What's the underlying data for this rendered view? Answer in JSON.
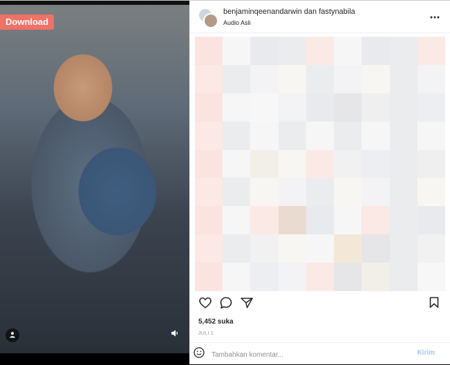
{
  "media": {
    "download_label": "Download",
    "user_icon": "user-icon",
    "sound_icon": "speaker-icon"
  },
  "post": {
    "authors": "benjaminqeenandarwin dan fastynabila",
    "audio": "Audio Asli",
    "more_icon": "more-horizontal-icon",
    "likes": "5,452 suka",
    "date": "JULI 1"
  },
  "comment": {
    "placeholder": "Tambahkan komentar...",
    "send_label": "Kirim",
    "emoji_icon": "emoji-icon"
  },
  "colors": {
    "download_bg": "#f07166",
    "send_color": "#9ec8f5",
    "text": "#262626",
    "muted": "#8e8e8e"
  }
}
